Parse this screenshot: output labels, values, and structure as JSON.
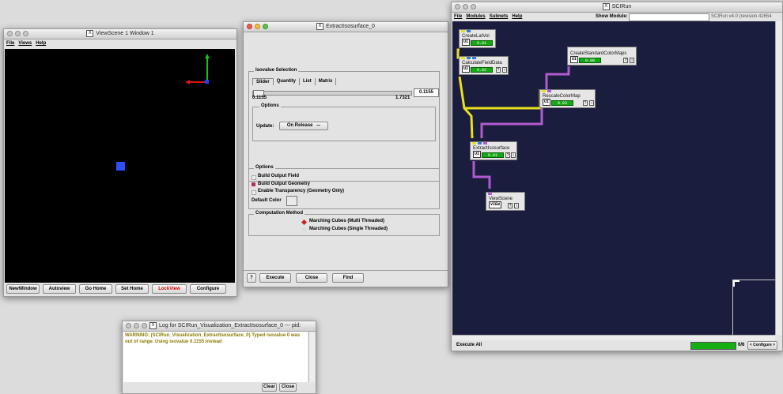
{
  "viewscene": {
    "title": "ViewScene 1 Window 1",
    "menu": [
      "File",
      "Views",
      "Help"
    ],
    "buttons": [
      "NewWindow",
      "Autoview",
      "Go Home",
      "Set Home",
      "LockView",
      "Configure"
    ],
    "lockview_color": "#cc0000"
  },
  "extract": {
    "title": "ExtractIsosurface_0",
    "isovalue_group": "Isovalue Selection",
    "tabs": [
      "Slider",
      "Quantity",
      "List",
      "Matrix"
    ],
    "slider_min": "0.1155",
    "slider_max": "1.7321",
    "slider_value": "0.1155",
    "options_inner_label": "Options",
    "update_label": "Update:",
    "update_value": "On Release",
    "options_label": "Options",
    "opt_build_field": "Build Output Field",
    "opt_build_geometry": "Build Output Geometry",
    "opt_transparency": "Enable Transparency (Geometry Only)",
    "default_color_label": "Default Color",
    "comp_label": "Computation Method",
    "comp_multi": "Marching Cubes (Multi Threaded)",
    "comp_single": "Marching Cubes (Single Threaded)",
    "help_btn": "?",
    "execute_btn": "Execute",
    "close_btn": "Close",
    "find_btn": "Find"
  },
  "log": {
    "title": "Log for SCIRun_Visualization_ExtractIsosurface_0 --- pid:",
    "message": "WARNING: (SCIRun_Visualization_ExtractIsosurface_0) Typed isovalue 0 was out of range.  Using isovalue 0.1155 instead",
    "message_color": "#8a7a00",
    "clear_btn": "Clear",
    "close_btn": "Close"
  },
  "scirun": {
    "title": "SCIRun",
    "menu": [
      "File",
      "Modules",
      "Subnets",
      "Help"
    ],
    "show_module_label": "Show Module:",
    "show_module_value": "",
    "version": "SCIRun v4.0 (revision 42654",
    "modules": [
      {
        "name": "CreateLatVol",
        "ui": "UI",
        "time": "0.01"
      },
      {
        "name": "CalculateFieldData",
        "ui": "UI",
        "time": "0.02"
      },
      {
        "name": "CreateStandardColorMaps",
        "ui": "UI",
        "time": "0.00"
      },
      {
        "name": "RescaleColorMap",
        "ui": "UI",
        "time": "0.03"
      },
      {
        "name": "ExtractIsosurface",
        "ui": "UI",
        "time": "0.01"
      },
      {
        "name": "ViewScene",
        "ui": "VIEW",
        "time": ""
      }
    ],
    "q_label": "?",
    "i_label": "i",
    "execute_all": "Execute All",
    "progress_text": "6/6",
    "progress_fraction": 1.0,
    "configure_btn": "< Configure >"
  }
}
